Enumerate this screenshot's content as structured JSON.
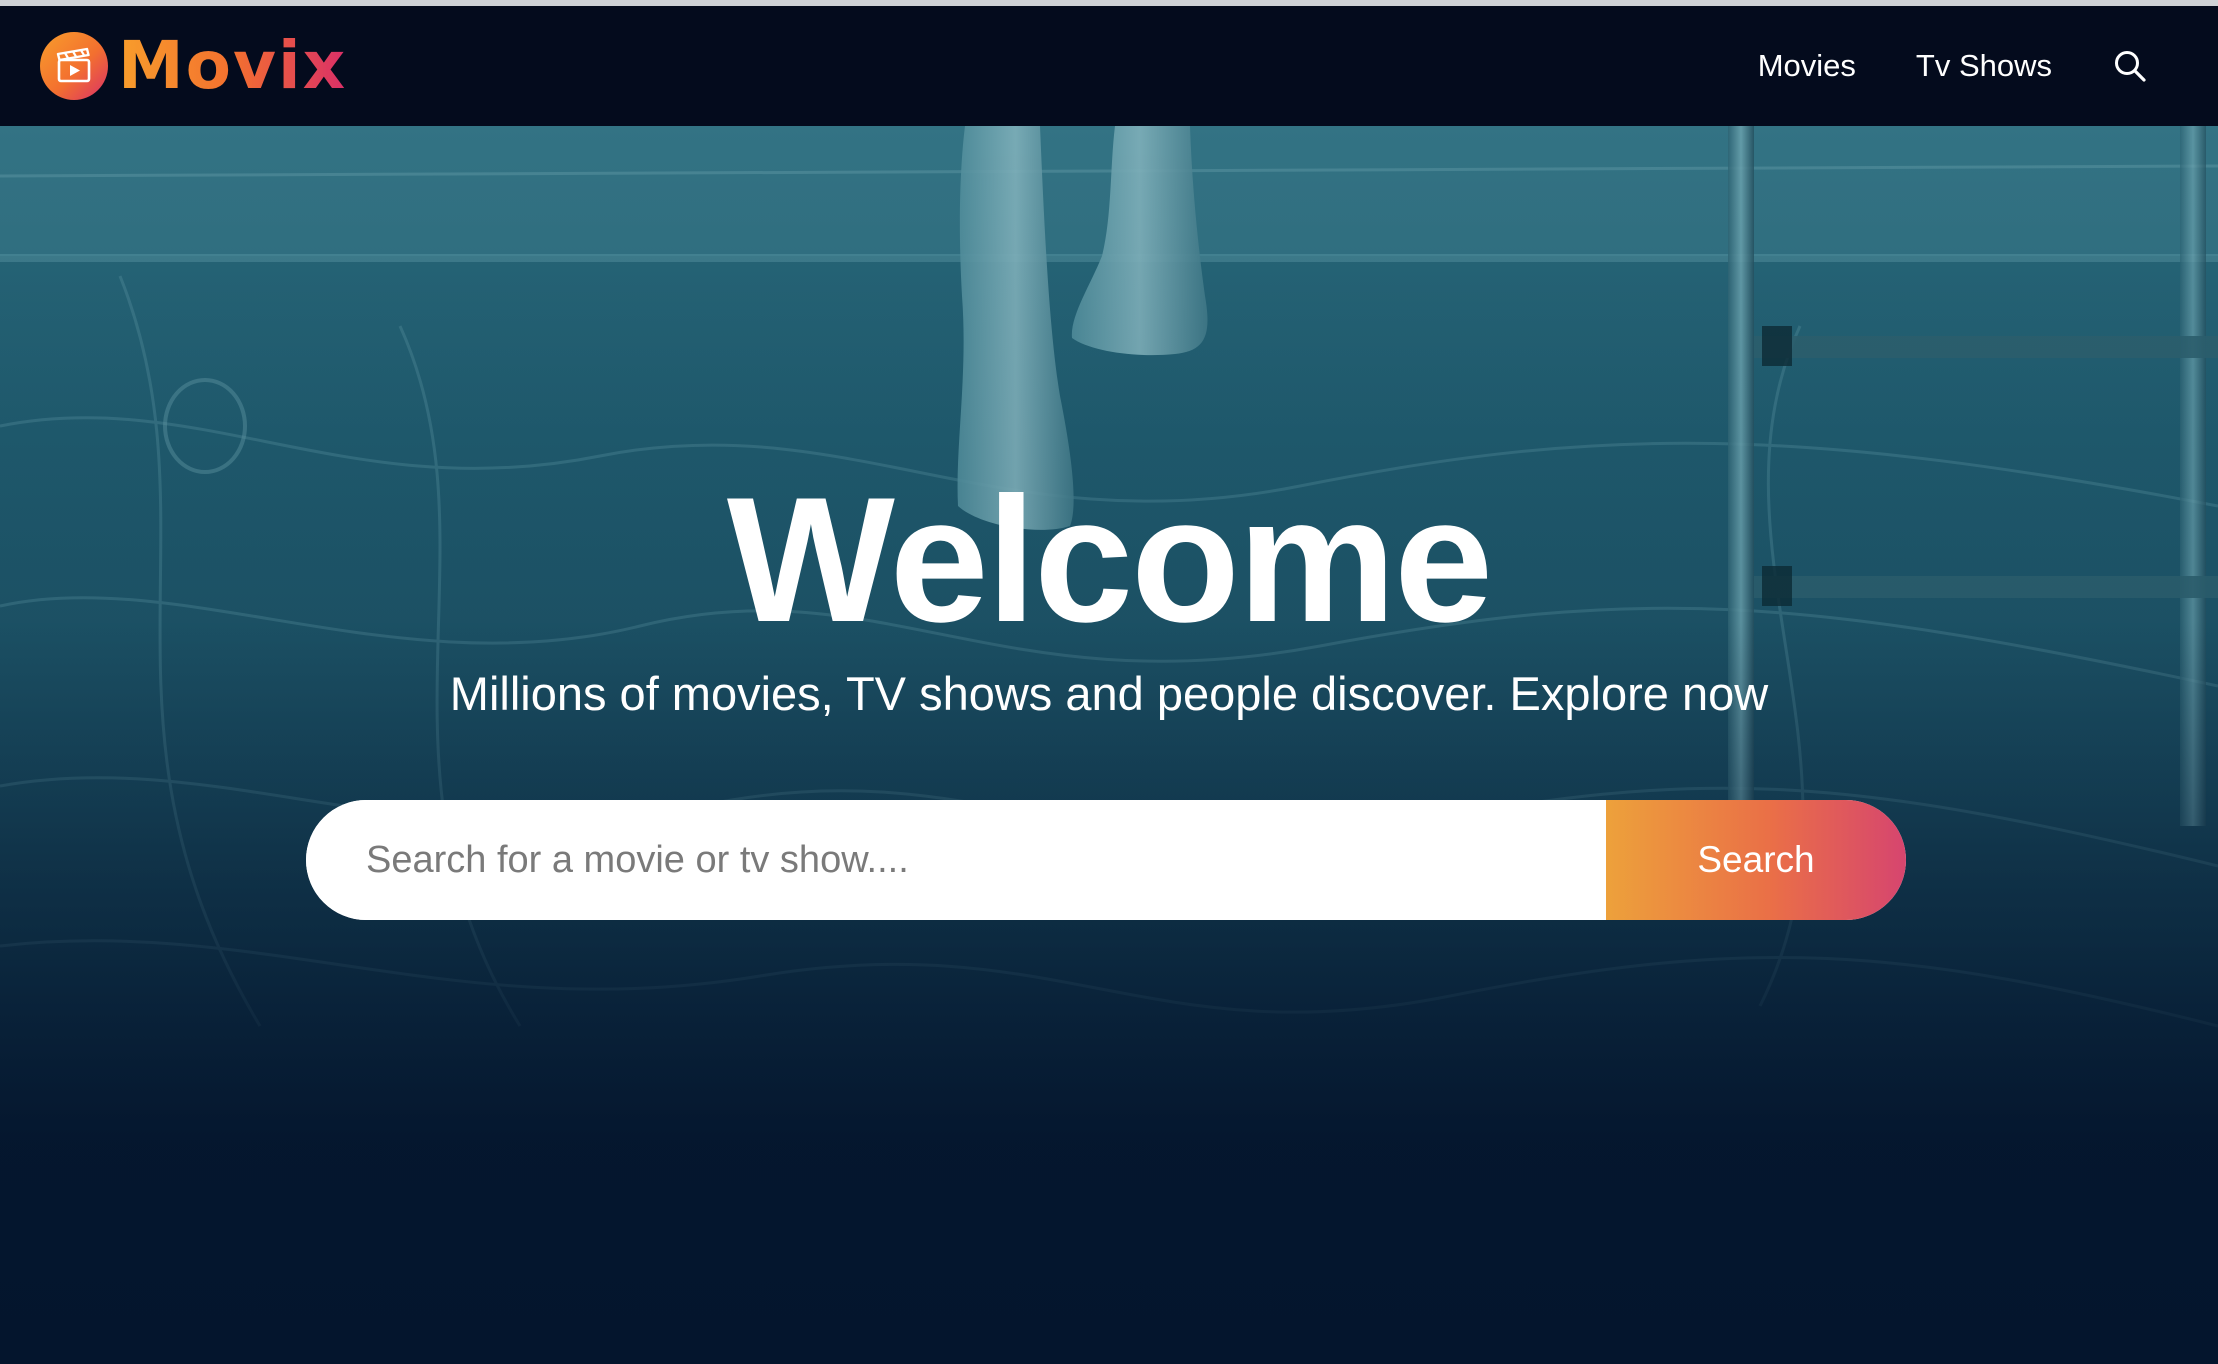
{
  "header": {
    "logo_text": "Movix",
    "nav": [
      {
        "label": "Movies"
      },
      {
        "label": "Tv Shows"
      }
    ],
    "search_icon": "search-icon"
  },
  "hero": {
    "title": "Welcome",
    "subtitle": "Millions of movies, TV shows and people discover. Explore now",
    "search": {
      "placeholder": "Search for a movie or tv show....",
      "button_label": "Search"
    },
    "background_image": "pool-with-dangling-legs-photo"
  },
  "colors": {
    "header_bg": "#040b1d",
    "page_bg": "#04152d",
    "accent_orange": "#f89e2c",
    "accent_pink": "#da2f68",
    "text_white": "#ffffff"
  }
}
